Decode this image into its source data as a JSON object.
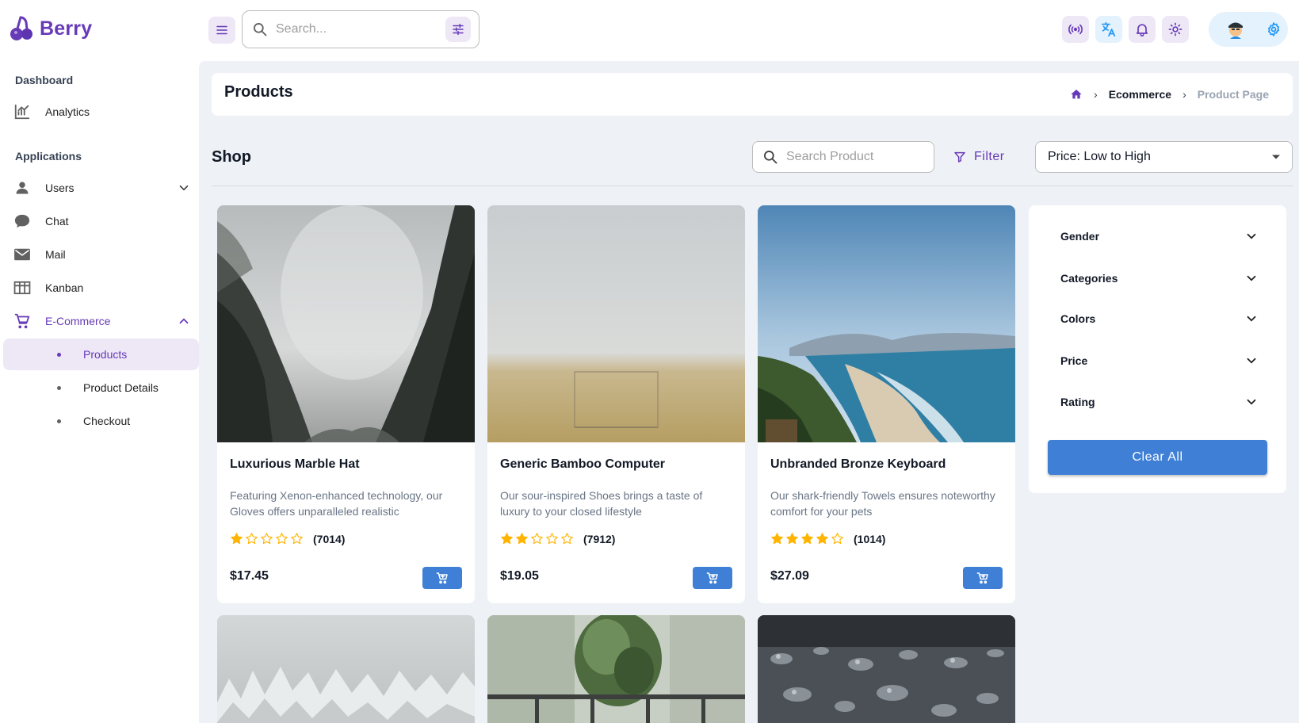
{
  "app": {
    "name": "Berry"
  },
  "header": {
    "search_placeholder": "Search...",
    "icons": [
      "menu-icon",
      "search-icon",
      "tune-icon",
      "broadcast-icon",
      "translate-icon",
      "bell-icon",
      "sun-icon",
      "avatar",
      "gear-icon"
    ]
  },
  "sidebar": {
    "dashboard_caption": "Dashboard",
    "analytics": "Analytics",
    "applications_caption": "Applications",
    "users": "Users",
    "chat": "Chat",
    "mail": "Mail",
    "kanban": "Kanban",
    "ecommerce": "E-Commerce",
    "products": "Products",
    "product_details": "Product Details",
    "checkout": "Checkout"
  },
  "breadcrumb": {
    "title": "Products",
    "ecommerce": "Ecommerce",
    "current": "Product Page"
  },
  "shop": {
    "title": "Shop",
    "search_placeholder": "Search Product",
    "filter_label": "Filter",
    "sort_value": "Price: Low to High"
  },
  "products": [
    {
      "name": "Luxurious Marble Hat",
      "description": "Featuring Xenon-enhanced technology, our Gloves offers unparalleled realistic",
      "rating": 1,
      "reviews": "(7014)",
      "price": "$17.45"
    },
    {
      "name": "Generic Bamboo Computer",
      "description": "Our sour-inspired Shoes brings a taste of luxury to your closed lifestyle",
      "rating": 2,
      "reviews": "(7912)",
      "price": "$19.05"
    },
    {
      "name": "Unbranded Bronze Keyboard",
      "description": "Our shark-friendly Towels ensures noteworthy comfort for your pets",
      "rating": 4,
      "reviews": "(1014)",
      "price": "$27.09"
    }
  ],
  "filters": {
    "gender": "Gender",
    "categories": "Categories",
    "colors": "Colors",
    "price": "Price",
    "rating": "Rating",
    "clear_all": "Clear All"
  },
  "colors": {
    "primary": "#673ab7",
    "accent_blue": "#3f80d6",
    "star": "#ffb400",
    "main_bg": "#eef2f6"
  }
}
